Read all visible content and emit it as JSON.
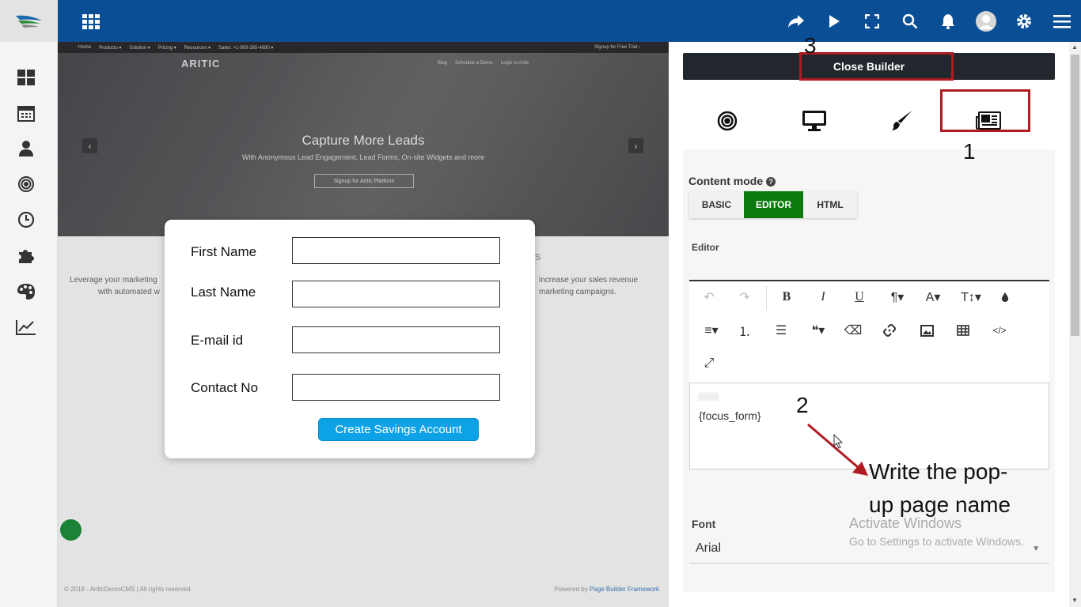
{
  "preview": {
    "nav": {
      "items": [
        "Home",
        "Products ▾",
        "Solution ▾",
        "Pricing ▾",
        "Resources ▾",
        "Sales: +1-909-265-4690 ▾"
      ],
      "cta": "Signup for Free Trial ›"
    },
    "brand": "ARITIC",
    "links": [
      "Blog",
      "Schedule a Demo",
      "Login to Aritic"
    ],
    "hero_title": "Capture More Leads",
    "hero_subtitle": "With Anonymous Lead Engagement, Lead Forms, On-site Widgets and more",
    "hero_button": "Signup for Aritic Platform",
    "body_left_1": "Leverage your marketing",
    "body_left_2": "with automated w",
    "body_right_1": "increase your sales revenue",
    "body_right_2": "marketing campaigns.",
    "heading_fragment": "s",
    "footer_left": "© 2018 - AriticDemoCMS | All rights reserved.",
    "footer_right_prefix": "Powered by",
    "footer_right_link": "Page Builder Framework"
  },
  "modal": {
    "fields": [
      {
        "label": "First Name",
        "value": ""
      },
      {
        "label": "Last Name",
        "value": ""
      },
      {
        "label": "E-mail id",
        "value": ""
      },
      {
        "label": "Contact No",
        "value": ""
      }
    ],
    "submit_label": "Create Savings Account"
  },
  "panel": {
    "close_label": "Close Builder",
    "tabs": [
      "target-icon",
      "desktop-icon",
      "brush-icon",
      "newspaper-icon"
    ],
    "content_mode_label": "Content mode",
    "modes": [
      {
        "label": "BASIC",
        "active": false
      },
      {
        "label": "EDITOR",
        "active": true
      },
      {
        "label": "HTML",
        "active": false
      }
    ],
    "editor_label": "Editor",
    "editor_content": "{focus_form}",
    "font_label": "Font",
    "font_value": "Arial"
  },
  "annotations": {
    "num_1": "1",
    "num_2": "2",
    "num_3": "3",
    "note": "Write the pop-up page name",
    "accent": "#b01a22"
  },
  "watermark": {
    "line1": "Activate Windows",
    "line2": "Go to Settings to activate Windows."
  },
  "colors": {
    "topbar": "#0a4f95",
    "active_mode": "#0b7a0e",
    "modal_button": "#0da2e6"
  }
}
